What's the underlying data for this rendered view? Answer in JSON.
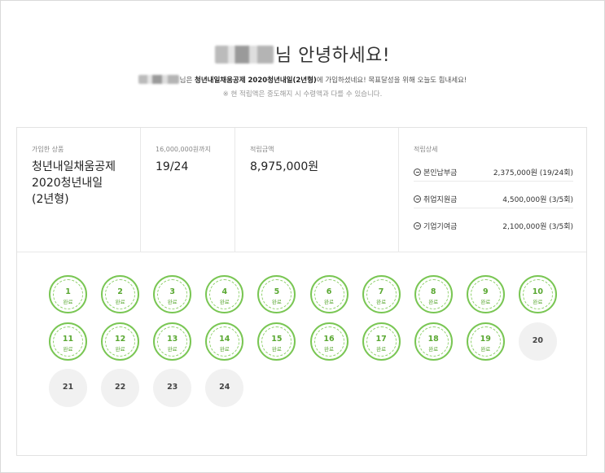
{
  "header": {
    "greeting_suffix": "님 안녕하세요!",
    "sub_suffix": "님은 ",
    "product_name": "청년내일채움공제 2020청년내일(2년형)",
    "sub_rest": "에 가입하셨네요! 목표달성을 위해 오늘도 힘내세요!",
    "note": "※ 현 적립액은 중도해지 시 수령액과 다를 수 있습니다."
  },
  "summary": {
    "product": {
      "label": "가입한 상품",
      "lines": [
        "청년내일채움공제",
        "2020청년내일",
        "(2년형)"
      ]
    },
    "progress": {
      "label": "16,000,000원까지",
      "value": "19/24"
    },
    "total": {
      "label": "적립금액",
      "value": "8,975,000원"
    },
    "details": {
      "label": "적립상세",
      "items": [
        {
          "name": "본인납부금",
          "value": "2,375,000원 (19/24회)"
        },
        {
          "name": "취업지원금",
          "value": "4,500,000원 (3/5회)"
        },
        {
          "name": "기업기여금",
          "value": "2,100,000원 (3/5회)"
        }
      ]
    }
  },
  "payments": {
    "done_label": "완료",
    "items": [
      {
        "num": "1",
        "done": true
      },
      {
        "num": "2",
        "done": true
      },
      {
        "num": "3",
        "done": true
      },
      {
        "num": "4",
        "done": true
      },
      {
        "num": "5",
        "done": true
      },
      {
        "num": "6",
        "done": true
      },
      {
        "num": "7",
        "done": true
      },
      {
        "num": "8",
        "done": true
      },
      {
        "num": "9",
        "done": true
      },
      {
        "num": "10",
        "done": true
      },
      {
        "num": "11",
        "done": true
      },
      {
        "num": "12",
        "done": true
      },
      {
        "num": "13",
        "done": true
      },
      {
        "num": "14",
        "done": true
      },
      {
        "num": "15",
        "done": true
      },
      {
        "num": "16",
        "done": true
      },
      {
        "num": "17",
        "done": true
      },
      {
        "num": "18",
        "done": true
      },
      {
        "num": "19",
        "done": true
      },
      {
        "num": "20",
        "done": false
      },
      {
        "num": "21",
        "done": false
      },
      {
        "num": "22",
        "done": false
      },
      {
        "num": "23",
        "done": false
      },
      {
        "num": "24",
        "done": false
      }
    ]
  },
  "colors": {
    "done_green": "#79c653",
    "pending_gray": "#f1f1f1"
  }
}
